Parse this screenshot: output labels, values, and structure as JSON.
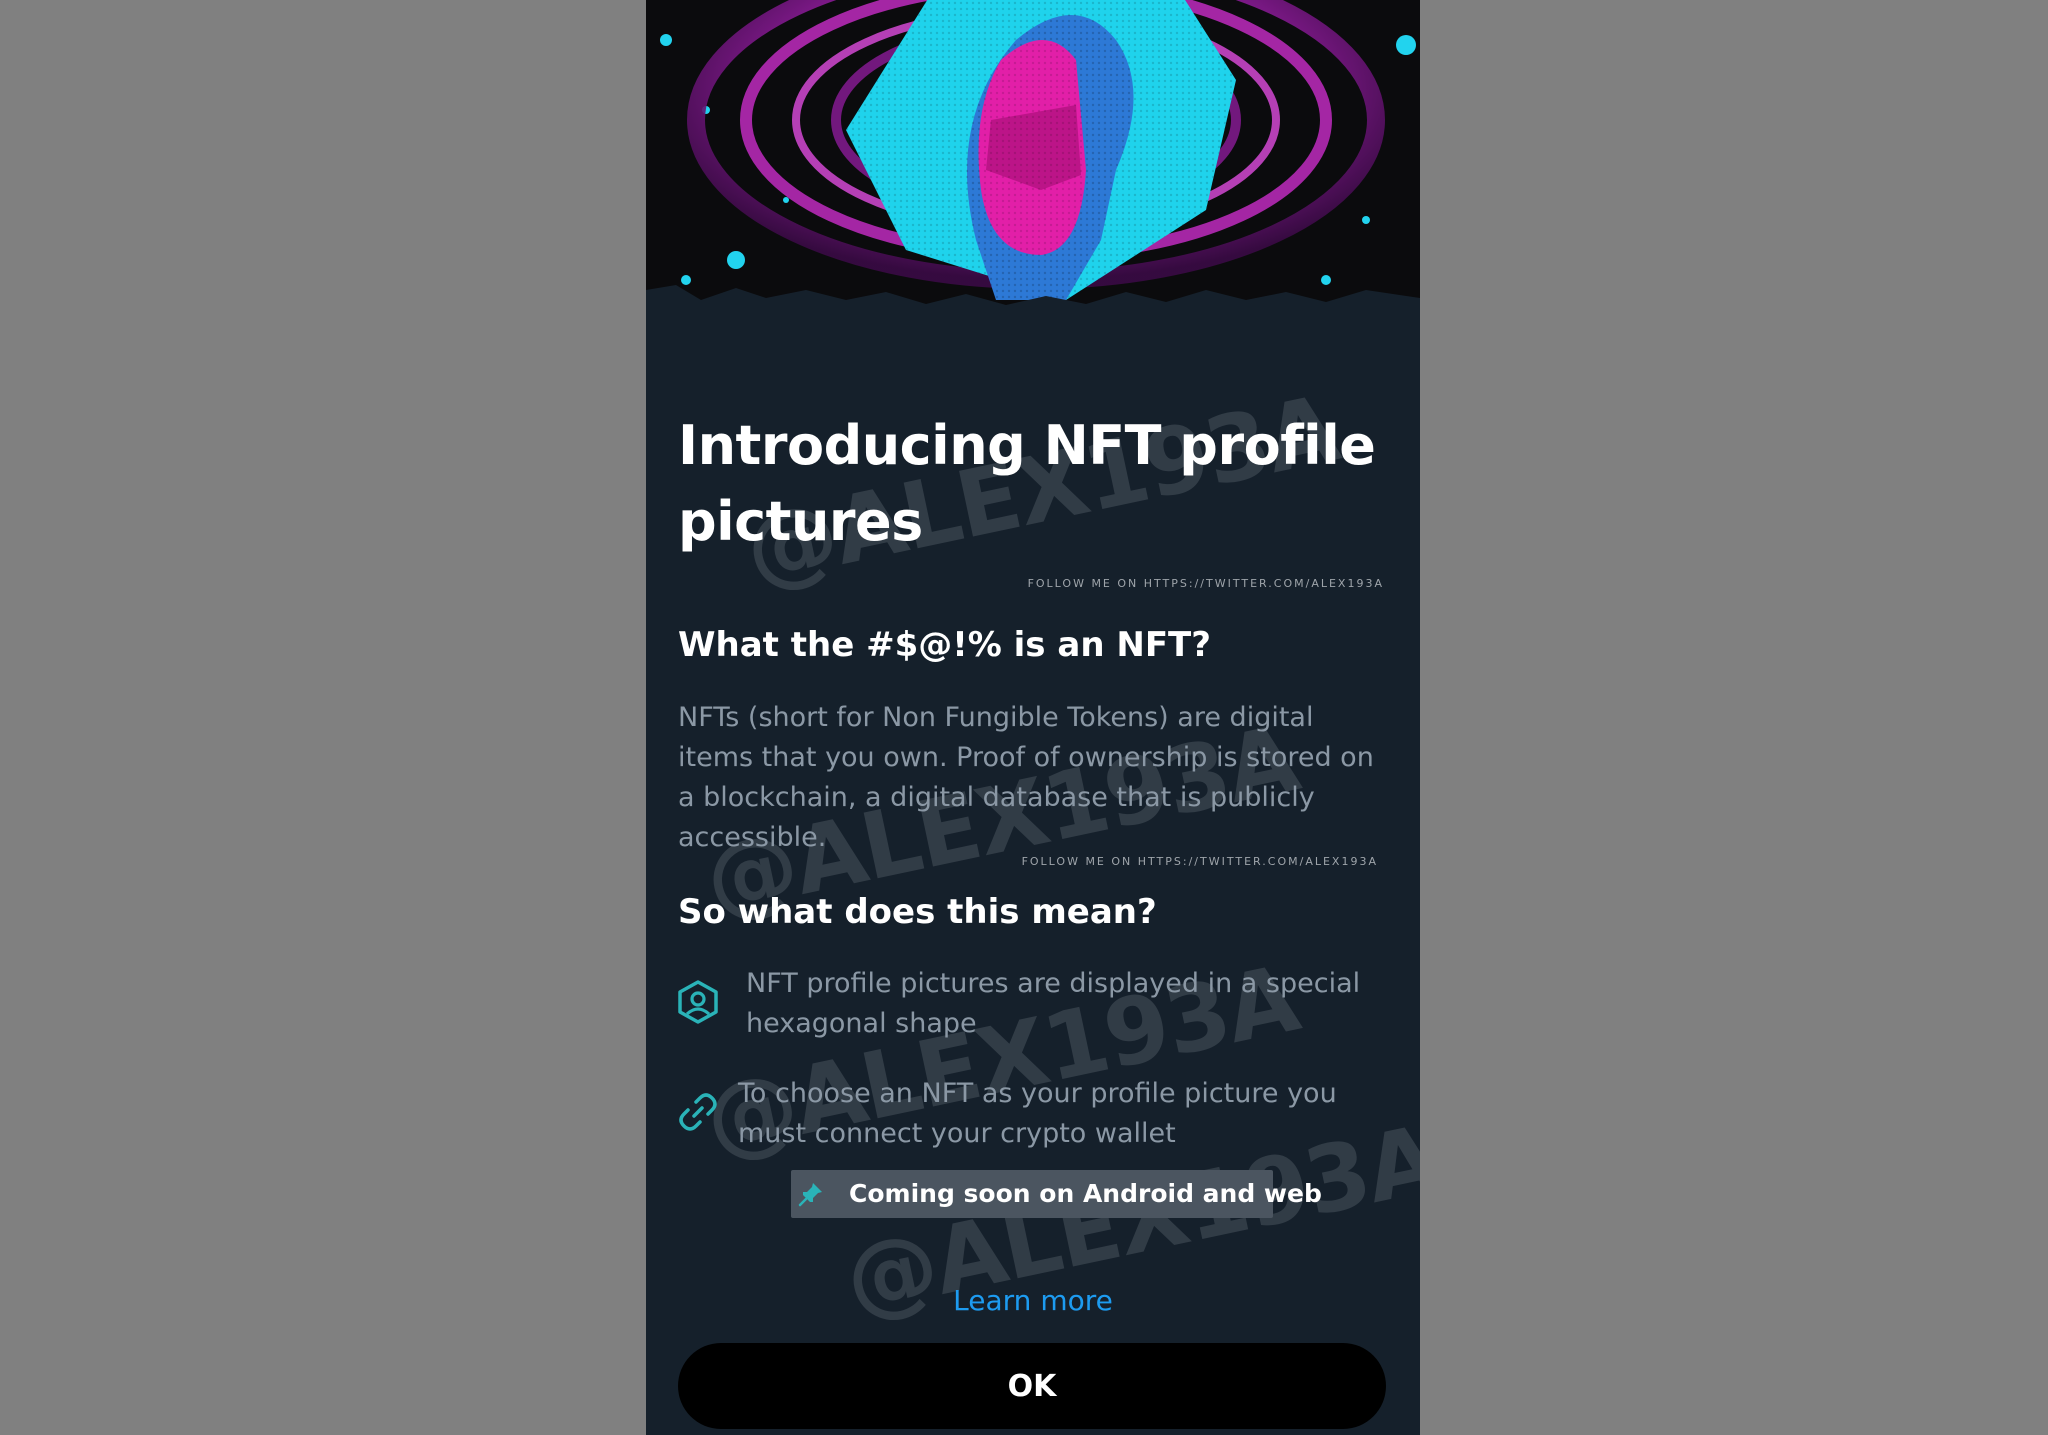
{
  "dialog": {
    "title": "Introducing NFT profile pictures",
    "watermark": "@ALEX193A",
    "follow_note": "FOLLOW ME ON HTTPS://TWITTER.COM/ALEX193A",
    "section1_heading": "What the #$@!% is an NFT?",
    "section1_body": "NFTs (short for Non Fungible Tokens) are digital items that you own. Proof of ownership is stored on a blockchain, a digital database that is publicly accessible.",
    "section2_heading": "So what does this mean?",
    "features": [
      {
        "icon": "hexagon-profile-icon",
        "text": "NFT profile pictures are displayed in a special hexagonal shape"
      },
      {
        "icon": "link-icon",
        "text": "To choose an NFT as your profile picture you must connect your crypto wallet"
      }
    ],
    "coming_soon": {
      "icon": "pin-icon",
      "text": "Coming soon on Android and web"
    },
    "learn_more": "Learn more",
    "ok_label": "OK"
  },
  "colors": {
    "background": "#15202b",
    "outer": "#808080",
    "accent_teal": "#2ab3b8",
    "link_blue": "#1d9bf0",
    "button": "#000000",
    "hero_cyan": "#22d3ee",
    "hero_magenta": "#e21fa8",
    "hero_purple": "#a01fa8"
  }
}
